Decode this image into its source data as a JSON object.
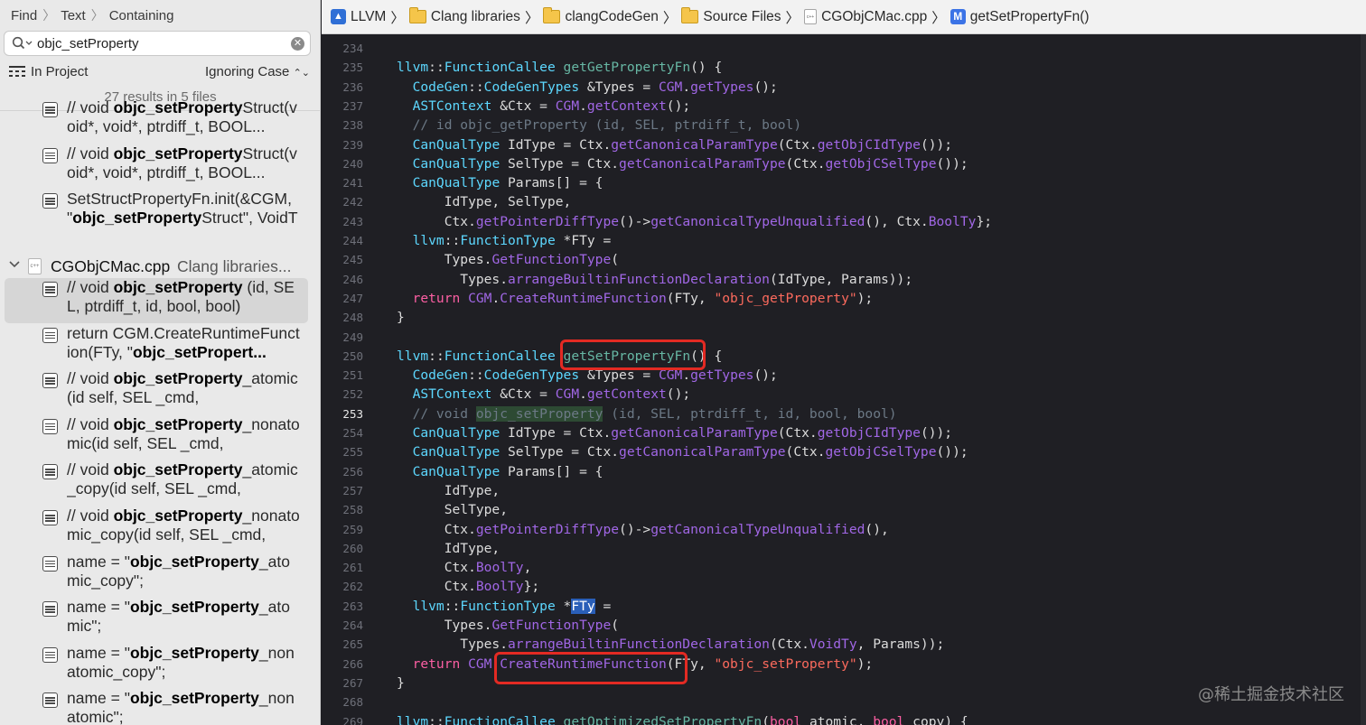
{
  "find": {
    "mode": "Find",
    "kind": "Text",
    "match": "Containing",
    "query": "objc_setProperty",
    "scope": "In Project",
    "case": "Ignoring Case",
    "summary": "27 results in 5 files"
  },
  "results_before_group": [
    {
      "pre": "// void ",
      "bold": "objc_setProperty",
      "post": "Struct(void*, void*, ptrdiff_t, BOOL..."
    },
    {
      "pre": "// void ",
      "bold": "objc_setProperty",
      "post": "Struct(void*, void*, ptrdiff_t, BOOL..."
    },
    {
      "pre": "SetStructPropertyFn.init(&CGM, \"",
      "bold": "objc_setProperty",
      "post": "Struct\", VoidTy, PtrTy, PtrTy,"
    }
  ],
  "file_group": {
    "name": "CGObjCMac.cpp",
    "path": "Clang libraries..."
  },
  "results_in_group": [
    {
      "pre": "// void ",
      "bold": "objc_setProperty",
      "post": " (id, SEL, ptrdiff_t, id, bool, bool)",
      "selected": true
    },
    {
      "pre": "return CGM.CreateRuntimeFunction(FTy, \"",
      "bold": "objc_setPropert...",
      "post": ""
    },
    {
      "pre": "// void ",
      "bold": "objc_setProperty",
      "post": "_atomic(id self, SEL _cmd,"
    },
    {
      "pre": "// void ",
      "bold": "objc_setProperty",
      "post": "_nonatomic(id self, SEL _cmd,"
    },
    {
      "pre": "// void ",
      "bold": "objc_setProperty",
      "post": "_atomic_copy(id self, SEL _cmd,"
    },
    {
      "pre": "// void ",
      "bold": "objc_setProperty",
      "post": "_nonatomic_copy(id self, SEL _cmd,"
    },
    {
      "pre": "name = \"",
      "bold": "objc_setProperty",
      "post": "_atomic_copy\";"
    },
    {
      "pre": "name = \"",
      "bold": "objc_setProperty",
      "post": "_atomic\";"
    },
    {
      "pre": "name = \"",
      "bold": "objc_setProperty",
      "post": "_nonatomic_copy\";"
    },
    {
      "pre": "name = \"",
      "bold": "objc_setProperty",
      "post": "_nonatomic\";"
    }
  ],
  "jumpbar": {
    "project": "LLVM",
    "folder1": "Clang libraries",
    "folder2": "clangCodeGen",
    "folder3": "Source Files",
    "file": "CGObjCMac.cpp",
    "symbol": "getSetPropertyFn()",
    "method_badge": "M"
  },
  "editor": {
    "current_line": 253,
    "watermark": "@稀土掘金技术社区",
    "lines": [
      {
        "n": 234,
        "t": []
      },
      {
        "n": 235,
        "t": [
          [
            "ty",
            "llvm"
          ],
          [
            "pl",
            "::"
          ],
          [
            "ty",
            "FunctionCallee"
          ],
          [
            "pl",
            " "
          ],
          [
            "fn",
            "getGetPropertyFn"
          ],
          [
            "pl",
            "() {"
          ]
        ]
      },
      {
        "n": 236,
        "t": [
          [
            "pl",
            "  "
          ],
          [
            "ty",
            "CodeGen"
          ],
          [
            "pl",
            "::"
          ],
          [
            "ty",
            "CodeGenTypes"
          ],
          [
            "pl",
            " &Types = "
          ],
          [
            "pf",
            "CGM"
          ],
          [
            "pl",
            "."
          ],
          [
            "pf",
            "getTypes"
          ],
          [
            "pl",
            "();"
          ]
        ]
      },
      {
        "n": 237,
        "t": [
          [
            "pl",
            "  "
          ],
          [
            "ty",
            "ASTContext"
          ],
          [
            "pl",
            " &Ctx = "
          ],
          [
            "pf",
            "CGM"
          ],
          [
            "pl",
            "."
          ],
          [
            "pf",
            "getContext"
          ],
          [
            "pl",
            "();"
          ]
        ]
      },
      {
        "n": 238,
        "t": [
          [
            "pl",
            "  "
          ],
          [
            "cm",
            "// id objc_getProperty (id, SEL, ptrdiff_t, bool)"
          ]
        ]
      },
      {
        "n": 239,
        "t": [
          [
            "pl",
            "  "
          ],
          [
            "ty",
            "CanQualType"
          ],
          [
            "pl",
            " IdType = Ctx."
          ],
          [
            "pf",
            "getCanonicalParamType"
          ],
          [
            "pl",
            "(Ctx."
          ],
          [
            "pf",
            "getObjCIdType"
          ],
          [
            "pl",
            "());"
          ]
        ]
      },
      {
        "n": 240,
        "t": [
          [
            "pl",
            "  "
          ],
          [
            "ty",
            "CanQualType"
          ],
          [
            "pl",
            " SelType = Ctx."
          ],
          [
            "pf",
            "getCanonicalParamType"
          ],
          [
            "pl",
            "(Ctx."
          ],
          [
            "pf",
            "getObjCSelType"
          ],
          [
            "pl",
            "());"
          ]
        ]
      },
      {
        "n": 241,
        "t": [
          [
            "pl",
            "  "
          ],
          [
            "ty",
            "CanQualType"
          ],
          [
            "pl",
            " Params[] = {"
          ]
        ]
      },
      {
        "n": 242,
        "t": [
          [
            "pl",
            "      IdType, SelType,"
          ]
        ]
      },
      {
        "n": 243,
        "t": [
          [
            "pl",
            "      Ctx."
          ],
          [
            "pf",
            "getPointerDiffType"
          ],
          [
            "pl",
            "()->"
          ],
          [
            "pf",
            "getCanonicalTypeUnqualified"
          ],
          [
            "pl",
            "(), Ctx."
          ],
          [
            "pf",
            "BoolTy"
          ],
          [
            "pl",
            "};"
          ]
        ]
      },
      {
        "n": 244,
        "t": [
          [
            "pl",
            "  "
          ],
          [
            "ty",
            "llvm"
          ],
          [
            "pl",
            "::"
          ],
          [
            "ty",
            "FunctionType"
          ],
          [
            "pl",
            " *FTy ="
          ]
        ]
      },
      {
        "n": 245,
        "t": [
          [
            "pl",
            "      Types."
          ],
          [
            "pf",
            "GetFunctionType"
          ],
          [
            "pl",
            "("
          ]
        ]
      },
      {
        "n": 246,
        "t": [
          [
            "pl",
            "        Types."
          ],
          [
            "pf",
            "arrangeBuiltinFunctionDeclaration"
          ],
          [
            "pl",
            "(IdType, Params));"
          ]
        ]
      },
      {
        "n": 247,
        "t": [
          [
            "pl",
            "  "
          ],
          [
            "kw",
            "return"
          ],
          [
            "pl",
            " "
          ],
          [
            "pf",
            "CGM"
          ],
          [
            "pl",
            "."
          ],
          [
            "pf",
            "CreateRuntimeFunction"
          ],
          [
            "pl",
            "(FTy, "
          ],
          [
            "str",
            "\"objc_getProperty\""
          ],
          [
            "pl",
            ");"
          ]
        ]
      },
      {
        "n": 248,
        "t": [
          [
            "pl",
            "}"
          ]
        ]
      },
      {
        "n": 249,
        "t": []
      },
      {
        "n": 250,
        "t": [
          [
            "ty",
            "llvm"
          ],
          [
            "pl",
            "::"
          ],
          [
            "ty",
            "FunctionCallee"
          ],
          [
            "pl",
            " "
          ],
          [
            "fn",
            "getSetPropertyFn"
          ],
          [
            "pl",
            "() {"
          ]
        ]
      },
      {
        "n": 251,
        "t": [
          [
            "pl",
            "  "
          ],
          [
            "ty",
            "CodeGen"
          ],
          [
            "pl",
            "::"
          ],
          [
            "ty",
            "CodeGenTypes"
          ],
          [
            "pl",
            " &Types = "
          ],
          [
            "pf",
            "CGM"
          ],
          [
            "pl",
            "."
          ],
          [
            "pf",
            "getTypes"
          ],
          [
            "pl",
            "();"
          ]
        ]
      },
      {
        "n": 252,
        "t": [
          [
            "pl",
            "  "
          ],
          [
            "ty",
            "ASTContext"
          ],
          [
            "pl",
            " &Ctx = "
          ],
          [
            "pf",
            "CGM"
          ],
          [
            "pl",
            "."
          ],
          [
            "pf",
            "getContext"
          ],
          [
            "pl",
            "();"
          ]
        ]
      },
      {
        "n": 253,
        "t": [
          [
            "pl",
            "  "
          ],
          [
            "cm",
            "// void "
          ],
          [
            "cmhl",
            "objc_setProperty"
          ],
          [
            "cm",
            " (id, SEL, ptrdiff_t, id, bool, bool)"
          ]
        ]
      },
      {
        "n": 254,
        "t": [
          [
            "pl",
            "  "
          ],
          [
            "ty",
            "CanQualType"
          ],
          [
            "pl",
            " IdType = Ctx."
          ],
          [
            "pf",
            "getCanonicalParamType"
          ],
          [
            "pl",
            "(Ctx."
          ],
          [
            "pf",
            "getObjCIdType"
          ],
          [
            "pl",
            "());"
          ]
        ]
      },
      {
        "n": 255,
        "t": [
          [
            "pl",
            "  "
          ],
          [
            "ty",
            "CanQualType"
          ],
          [
            "pl",
            " SelType = Ctx."
          ],
          [
            "pf",
            "getCanonicalParamType"
          ],
          [
            "pl",
            "(Ctx."
          ],
          [
            "pf",
            "getObjCSelType"
          ],
          [
            "pl",
            "());"
          ]
        ]
      },
      {
        "n": 256,
        "t": [
          [
            "pl",
            "  "
          ],
          [
            "ty",
            "CanQualType"
          ],
          [
            "pl",
            " Params[] = {"
          ]
        ]
      },
      {
        "n": 257,
        "t": [
          [
            "pl",
            "      IdType,"
          ]
        ]
      },
      {
        "n": 258,
        "t": [
          [
            "pl",
            "      SelType,"
          ]
        ]
      },
      {
        "n": 259,
        "t": [
          [
            "pl",
            "      Ctx."
          ],
          [
            "pf",
            "getPointerDiffType"
          ],
          [
            "pl",
            "()->"
          ],
          [
            "pf",
            "getCanonicalTypeUnqualified"
          ],
          [
            "pl",
            "(),"
          ]
        ]
      },
      {
        "n": 260,
        "t": [
          [
            "pl",
            "      IdType,"
          ]
        ]
      },
      {
        "n": 261,
        "t": [
          [
            "pl",
            "      Ctx."
          ],
          [
            "pf",
            "BoolTy"
          ],
          [
            "pl",
            ","
          ]
        ]
      },
      {
        "n": 262,
        "t": [
          [
            "pl",
            "      Ctx."
          ],
          [
            "pf",
            "BoolTy"
          ],
          [
            "pl",
            "};"
          ]
        ]
      },
      {
        "n": 263,
        "t": [
          [
            "pl",
            "  "
          ],
          [
            "ty",
            "llvm"
          ],
          [
            "pl",
            "::"
          ],
          [
            "ty",
            "FunctionType"
          ],
          [
            "pl",
            " *"
          ],
          [
            "sel",
            "FTy"
          ],
          [
            "pl",
            " ="
          ]
        ]
      },
      {
        "n": 264,
        "t": [
          [
            "pl",
            "      Types."
          ],
          [
            "pf",
            "GetFunctionType"
          ],
          [
            "pl",
            "("
          ]
        ]
      },
      {
        "n": 265,
        "t": [
          [
            "pl",
            "        Types."
          ],
          [
            "pf",
            "arrangeBuiltinFunctionDeclaration"
          ],
          [
            "pl",
            "(Ctx."
          ],
          [
            "pf",
            "VoidTy"
          ],
          [
            "pl",
            ", Params));"
          ]
        ]
      },
      {
        "n": 266,
        "t": [
          [
            "pl",
            "  "
          ],
          [
            "kw",
            "return"
          ],
          [
            "pl",
            " "
          ],
          [
            "pf",
            "CGM"
          ],
          [
            "pl",
            "."
          ],
          [
            "pf",
            "CreateRuntimeFunction"
          ],
          [
            "pl",
            "(FTy, "
          ],
          [
            "str",
            "\"objc_setProperty\""
          ],
          [
            "pl",
            ");"
          ]
        ]
      },
      {
        "n": 267,
        "t": [
          [
            "pl",
            "}"
          ]
        ]
      },
      {
        "n": 268,
        "t": []
      },
      {
        "n": 269,
        "t": [
          [
            "ty",
            "llvm"
          ],
          [
            "pl",
            "::"
          ],
          [
            "ty",
            "FunctionCallee"
          ],
          [
            "pl",
            " "
          ],
          [
            "fn",
            "getOptimizedSetPropertyFn"
          ],
          [
            "pl",
            "("
          ],
          [
            "kw",
            "bool"
          ],
          [
            "pl",
            " atomic, "
          ],
          [
            "kw",
            "bool"
          ],
          [
            "pl",
            " copy) {"
          ]
        ]
      }
    ]
  }
}
